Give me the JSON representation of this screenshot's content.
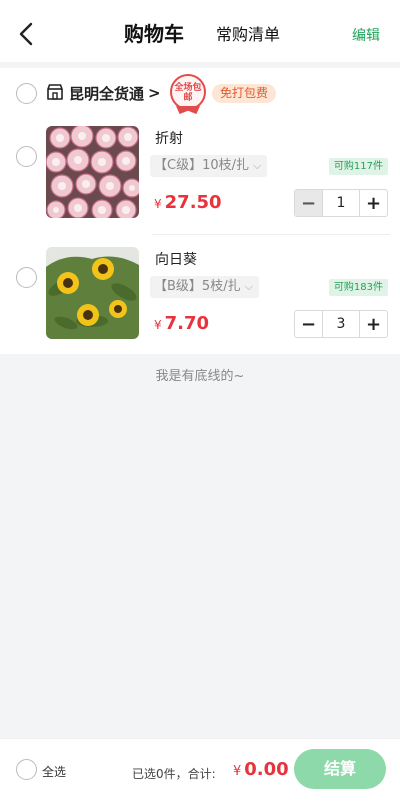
{
  "header": {
    "title": "购物车",
    "subtitle": "常购清单",
    "edit_label": "编辑"
  },
  "store": {
    "name": "昆明全货通",
    "chevron": ">",
    "stamp_text": "全场包邮",
    "free_shipping_tag": "免打包费"
  },
  "items": [
    {
      "name": "折射",
      "spec": "【C级】10枝/扎",
      "stock": "可购117件",
      "currency": "¥",
      "price": "27.50",
      "quantity": "1",
      "minus_disabled": true,
      "image": "pink-roses"
    },
    {
      "name": "向日葵",
      "spec": "【B级】5枝/扎",
      "stock": "可购183件",
      "currency": "¥",
      "price": "7.70",
      "quantity": "3",
      "minus_disabled": false,
      "image": "sunflowers"
    }
  ],
  "bottom_note": "我是有底线的~",
  "footer": {
    "select_all_label": "全选",
    "summary": "已选0件，合计:",
    "currency": "¥",
    "total": "0.00",
    "checkout_label": "结算"
  },
  "colors": {
    "accent": "#20a35a",
    "price": "#e8323c",
    "checkout_bg": "#8ed9aa"
  }
}
